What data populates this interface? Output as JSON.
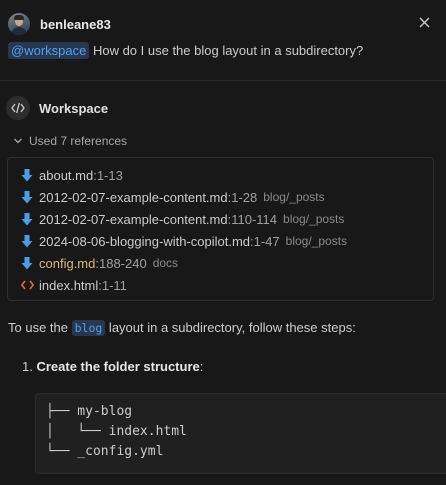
{
  "user": {
    "name": "benleane83",
    "agent_tag": "@workspace",
    "message": " How do I use the blog layout in a subdirectory?"
  },
  "response": {
    "agent_name": "Workspace",
    "references_toggle": "Used 7 references",
    "references": [
      {
        "icon": "markdown-icon",
        "name": "about.md",
        "lines": ":1-13",
        "path": ""
      },
      {
        "icon": "markdown-icon",
        "name": "2012-02-07-example-content.md",
        "lines": ":1-28",
        "path": "blog/_posts"
      },
      {
        "icon": "markdown-icon",
        "name": "2012-02-07-example-content.md",
        "lines": ":110-114",
        "path": "blog/_posts"
      },
      {
        "icon": "markdown-icon",
        "name": "2024-08-06-blogging-with-copilot.md",
        "lines": ":1-47",
        "path": "blog/_posts"
      },
      {
        "icon": "markdown-icon",
        "name": "config.md",
        "lines": ":188-240",
        "path": "docs"
      },
      {
        "icon": "html-icon",
        "name": "index.html",
        "lines": ":1-11",
        "path": ""
      }
    ],
    "intro_before": "To use the ",
    "intro_code": "blog",
    "intro_after": " layout in a subdirectory, follow these steps:",
    "step_number": "1.",
    "step_bold": "Create the folder structure",
    "step_after": ":",
    "code_lines": [
      "├── my-blog",
      "│   └── index.html",
      "└── _config.yml"
    ]
  },
  "colors": {
    "background": "#181818",
    "accent_blue": "#4fa1ee",
    "markdown_icon": "#4a9ee8",
    "html_icon": "#e8673c",
    "modified_file": "#d7ba7d"
  }
}
